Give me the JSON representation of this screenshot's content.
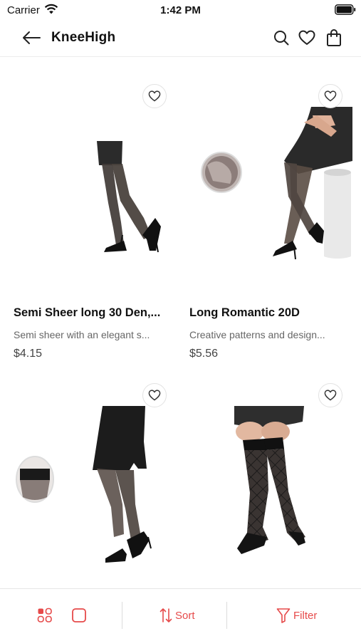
{
  "status_bar": {
    "carrier": "Carrier",
    "time": "1:42 PM"
  },
  "header": {
    "title": "KneeHigh",
    "icons": [
      "back-arrow-icon",
      "search-icon",
      "heart-icon",
      "shopping-bag-icon"
    ]
  },
  "products": [
    {
      "title": "Semi Sheer long 30 Den,...",
      "description": "Semi sheer with an elegant s...",
      "price": "$4.15",
      "favorited": false
    },
    {
      "title": "Long Romantic 20D",
      "description": "Creative patterns and design...",
      "price": "$5.56",
      "favorited": false
    },
    {
      "title": "",
      "description": "",
      "price": "",
      "favorited": false
    },
    {
      "title": "",
      "description": "",
      "price": "",
      "favorited": false
    }
  ],
  "bottom_bar": {
    "sort_label": "Sort",
    "filter_label": "Filter",
    "view_icons": [
      "grid-view-icon",
      "single-view-icon"
    ]
  },
  "colors": {
    "accent": "#e64a4a",
    "text": "#111111",
    "muted": "#666666"
  }
}
